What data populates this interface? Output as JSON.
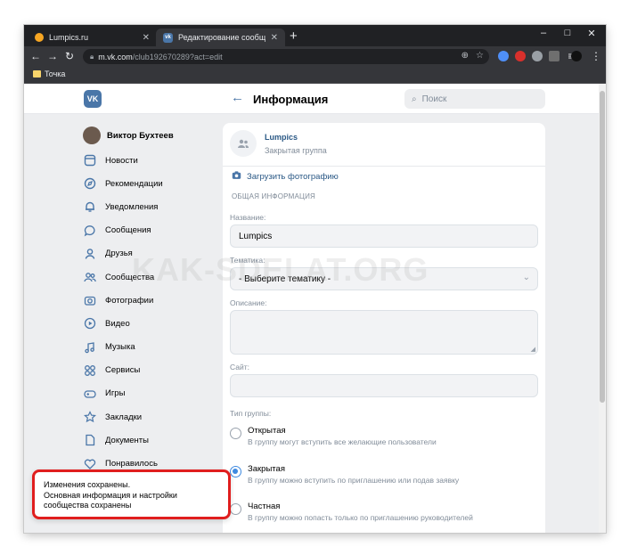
{
  "browser": {
    "tabs": [
      {
        "title": "Lumpics.ru",
        "active": false,
        "favicon": "orange-circle-icon"
      },
      {
        "title": "Редактирование сообщества Lu",
        "active": true,
        "favicon": "vk-icon"
      }
    ],
    "new_tab_symbol": "+",
    "window_controls": {
      "minimize": "–",
      "maximize": "□",
      "close": "✕"
    },
    "url_host": "m.vk.com",
    "url_path": "/club192670289?act=edit",
    "bookmark_folder": "Точка"
  },
  "header": {
    "logo_text": "VK",
    "title": "Информация",
    "search_placeholder": "Поиск"
  },
  "menu": {
    "profile_name": "Виктор Бухтеев",
    "items": [
      {
        "label": "Новости",
        "icon": "newspaper-icon"
      },
      {
        "label": "Рекомендации",
        "icon": "compass-icon"
      },
      {
        "label": "Уведомления",
        "icon": "bell-icon"
      },
      {
        "label": "Сообщения",
        "icon": "chat-bubble-icon"
      },
      {
        "label": "Друзья",
        "icon": "user-icon"
      },
      {
        "label": "Сообщества",
        "icon": "users-icon"
      },
      {
        "label": "Фотографии",
        "icon": "camera-icon"
      },
      {
        "label": "Видео",
        "icon": "play-icon"
      },
      {
        "label": "Музыка",
        "icon": "music-note-icon"
      },
      {
        "label": "Сервисы",
        "icon": "grid-icon"
      },
      {
        "label": "Игры",
        "icon": "gamepad-icon"
      },
      {
        "label": "Закладки",
        "icon": "star-icon"
      },
      {
        "label": "Документы",
        "icon": "document-icon"
      },
      {
        "label": "Понравилось",
        "icon": "heart-icon"
      }
    ]
  },
  "group": {
    "name": "Lumpics",
    "type": "Закрытая группа",
    "upload_photo": "Загрузить фотографию"
  },
  "form": {
    "section_title": "ОБЩАЯ ИНФОРМАЦИЯ",
    "name_label": "Название:",
    "name_value": "Lumpics",
    "topic_label": "Тематика:",
    "topic_value": "- Выберите тематику -",
    "description_label": "Описание:",
    "description_value": "",
    "site_label": "Сайт:",
    "site_value": "",
    "group_type_label": "Тип группы:",
    "group_types": [
      {
        "title": "Открытая",
        "desc": "В группу могут вступить все желающие пользователи",
        "checked": false
      },
      {
        "title": "Закрытая",
        "desc": "В группу можно вступить по приглашению или подав заявку",
        "checked": true
      },
      {
        "title": "Частная",
        "desc": "В группу можно попасть только по приглашению руководителей",
        "checked": false
      }
    ]
  },
  "toast": {
    "line1": "Изменения сохранены.",
    "line2": "Основная информация и настройки",
    "line3": "сообщества сохранены"
  },
  "watermark": "KAK-SDELAT.ORG",
  "colors": {
    "vk_blue": "#4a76a8",
    "link_blue": "#2a5885",
    "radio_blue": "#3f8ae0",
    "toast_border": "#e01e1e",
    "page_bg": "#edeef0",
    "browser_dark": "#202124"
  }
}
